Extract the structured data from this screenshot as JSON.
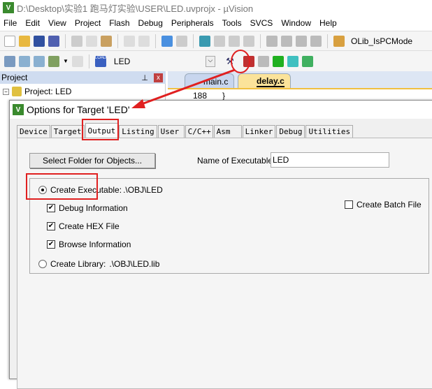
{
  "window": {
    "title": "D:\\Desktop\\实验1 跑马灯实验\\USER\\LED.uvprojx - µVision",
    "logo": "V"
  },
  "menu": [
    "File",
    "Edit",
    "View",
    "Project",
    "Flash",
    "Debug",
    "Peripherals",
    "Tools",
    "SVCS",
    "Window",
    "Help"
  ],
  "toolbar": {
    "function_combo": "OLib_IsPCMode",
    "target_select": "LED",
    "load_label": "LOAD"
  },
  "project_panel": {
    "title": "Project",
    "root": "Project: LED",
    "pin": "ᵖ",
    "close": "x"
  },
  "editor": {
    "tabs": [
      {
        "label": "main.c",
        "active": false
      },
      {
        "label": "delay.c",
        "active": true
      }
    ],
    "line_number": "188",
    "line_code": "}"
  },
  "dialog": {
    "title": "Options for Target 'LED'",
    "tabs": [
      "Device",
      "Target",
      "Output",
      "Listing",
      "User",
      "C/C++",
      "Asm",
      "Linker",
      "Debug",
      "Utilities"
    ],
    "active_tab": "Output",
    "select_folder_button": "Select Folder for Objects...",
    "name_label": "Name of Executable:",
    "name_value": "LED",
    "create_executable": {
      "label": "Create Executable:",
      "path": ".\\OBJ\\LED",
      "selected": true
    },
    "debug_info": {
      "label": "Debug Information",
      "checked": true
    },
    "create_hex": {
      "label": "Create HEX File",
      "checked": true
    },
    "browse_info": {
      "label": "Browse Information",
      "checked": true
    },
    "create_library": {
      "label": "Create Library:",
      "path": ".\\OBJ\\LED.lib",
      "selected": false
    },
    "create_batch": {
      "label": "Create Batch File",
      "checked": false
    }
  },
  "annotation_color": "#e02020"
}
